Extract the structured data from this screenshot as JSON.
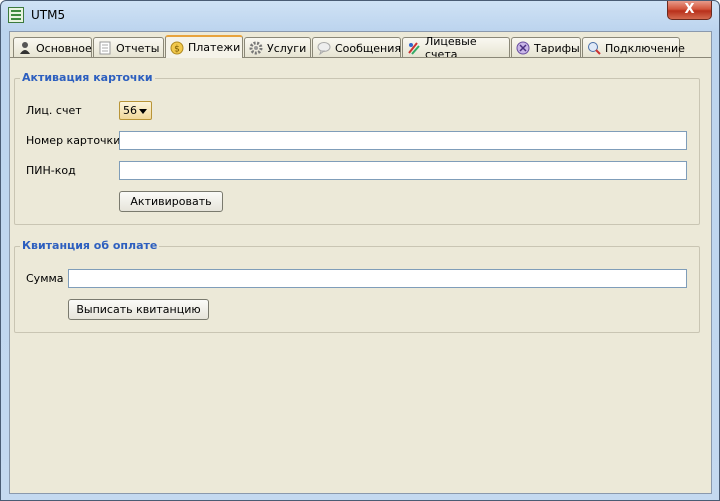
{
  "window": {
    "title": "UTM5",
    "close_label": "X"
  },
  "tabs": [
    {
      "label": "Основное",
      "icon": "user-icon",
      "active": false
    },
    {
      "label": "Отчеты",
      "icon": "report-icon",
      "active": false
    },
    {
      "label": "Платежи",
      "icon": "coin-icon",
      "active": true
    },
    {
      "label": "Услуги",
      "icon": "gear-icon",
      "active": false
    },
    {
      "label": "Сообщения",
      "icon": "message-icon",
      "active": false
    },
    {
      "label": "Лицевые счета",
      "icon": "accounts-icon",
      "active": false
    },
    {
      "label": "Тарифы",
      "icon": "tariff-icon",
      "active": false
    },
    {
      "label": "Подключение",
      "icon": "connection-icon",
      "active": false
    }
  ],
  "card_activation": {
    "legend": "Активация карточки",
    "account_label": "Лиц. счет",
    "account_value": "56",
    "card_number_label": "Номер карточки",
    "card_number_value": "",
    "pin_label": "ПИН-код",
    "pin_value": "",
    "activate_button": "Активировать"
  },
  "receipt": {
    "legend": "Квитанция об оплате",
    "amount_label": "Сумма",
    "amount_value": "",
    "issue_button": "Выписать квитанцию"
  },
  "colors": {
    "legend_text": "#2d5fbf",
    "panel_bg": "#ece9d8",
    "active_tab_accent": "#e8a33c"
  }
}
